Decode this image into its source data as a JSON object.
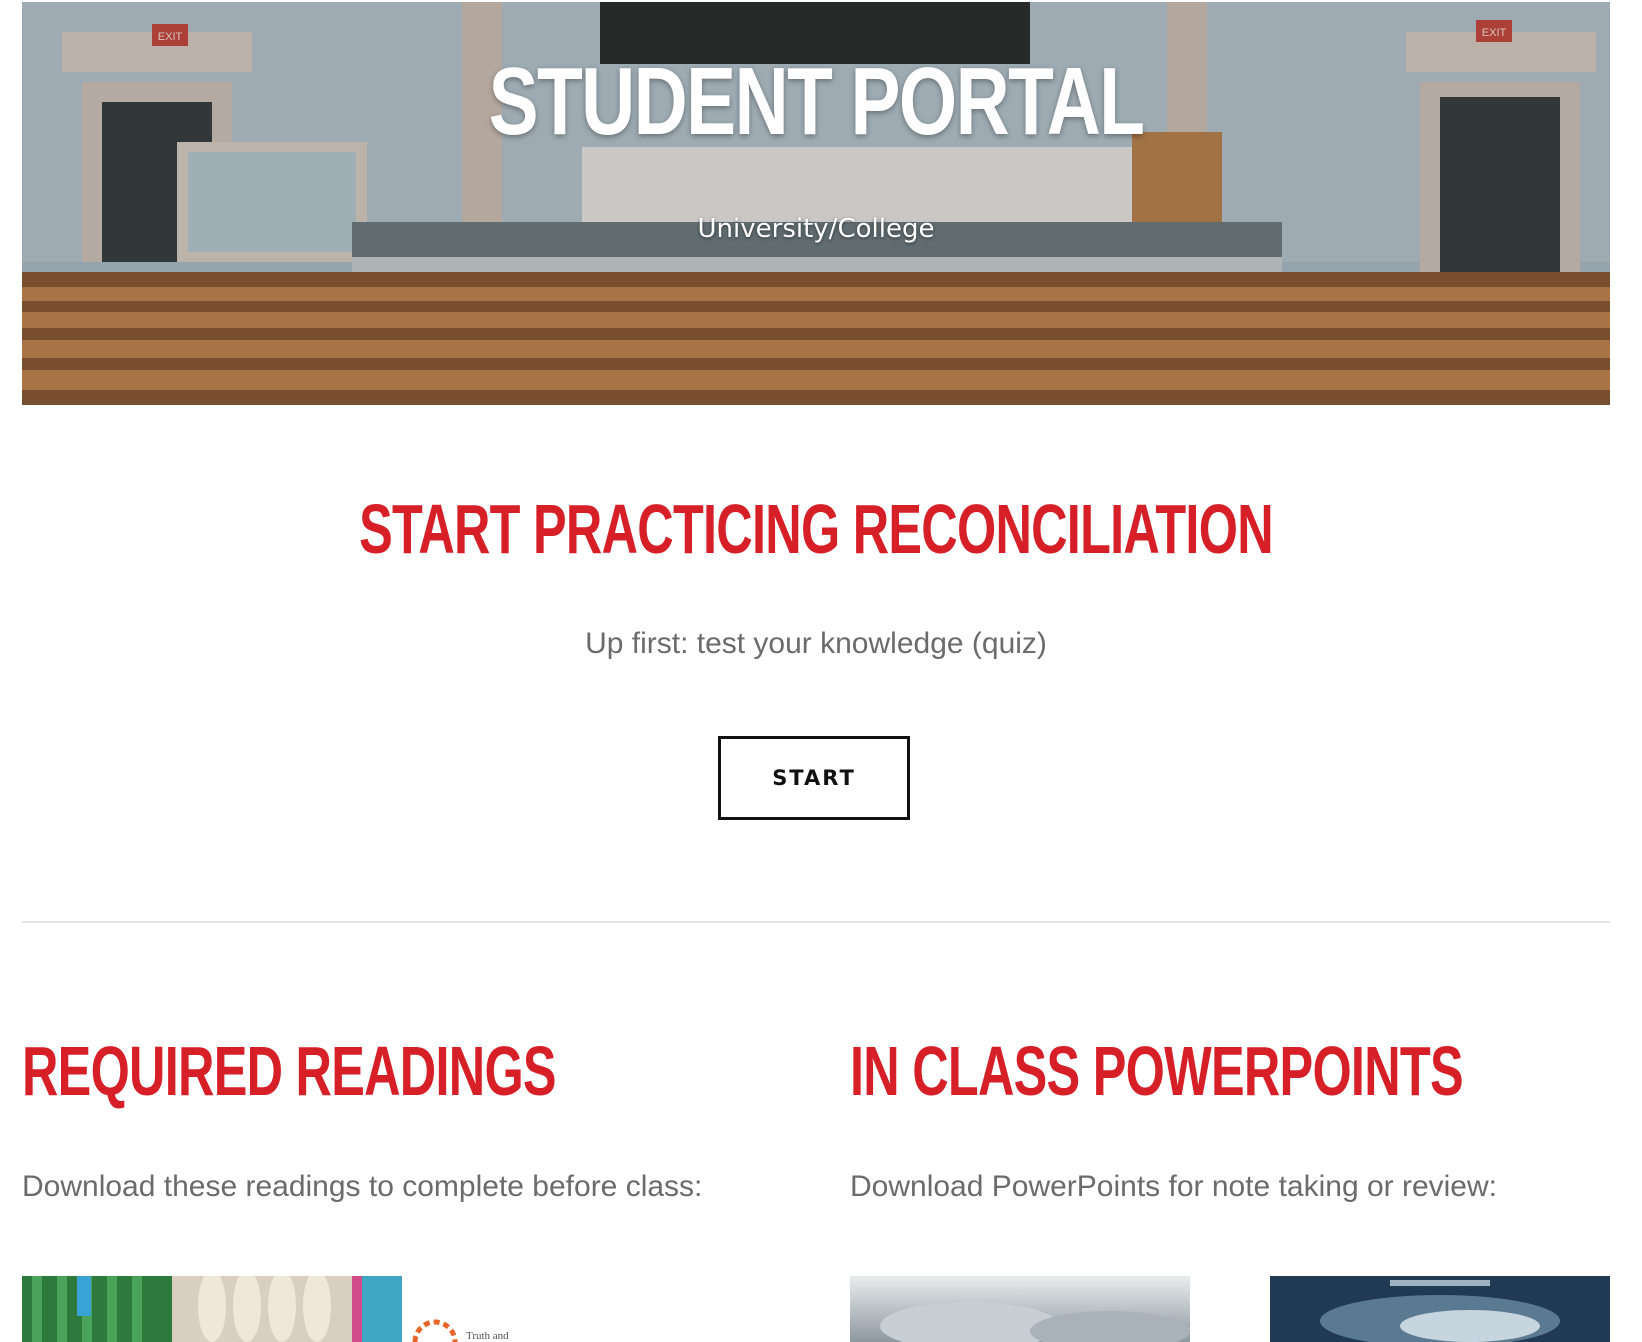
{
  "hero": {
    "title": "STUDENT PORTAL",
    "subtitle": "University/College",
    "exit_sign": "EXIT"
  },
  "cta": {
    "heading": "START PRACTICING RECONCILIATION",
    "text": "Up first: test your knowledge (quiz)",
    "button_label": "START"
  },
  "readings": {
    "heading": "REQUIRED READINGS",
    "text": "Download these readings to complete before class:",
    "thumb2_caption": "Truth and"
  },
  "powerpoints": {
    "heading": "IN CLASS POWERPOINTS",
    "text": "Download PowerPoints for note taking or review:"
  },
  "colors": {
    "accent_red": "#d71f27",
    "body_gray": "#6b6b6b",
    "button_border": "#111111"
  }
}
